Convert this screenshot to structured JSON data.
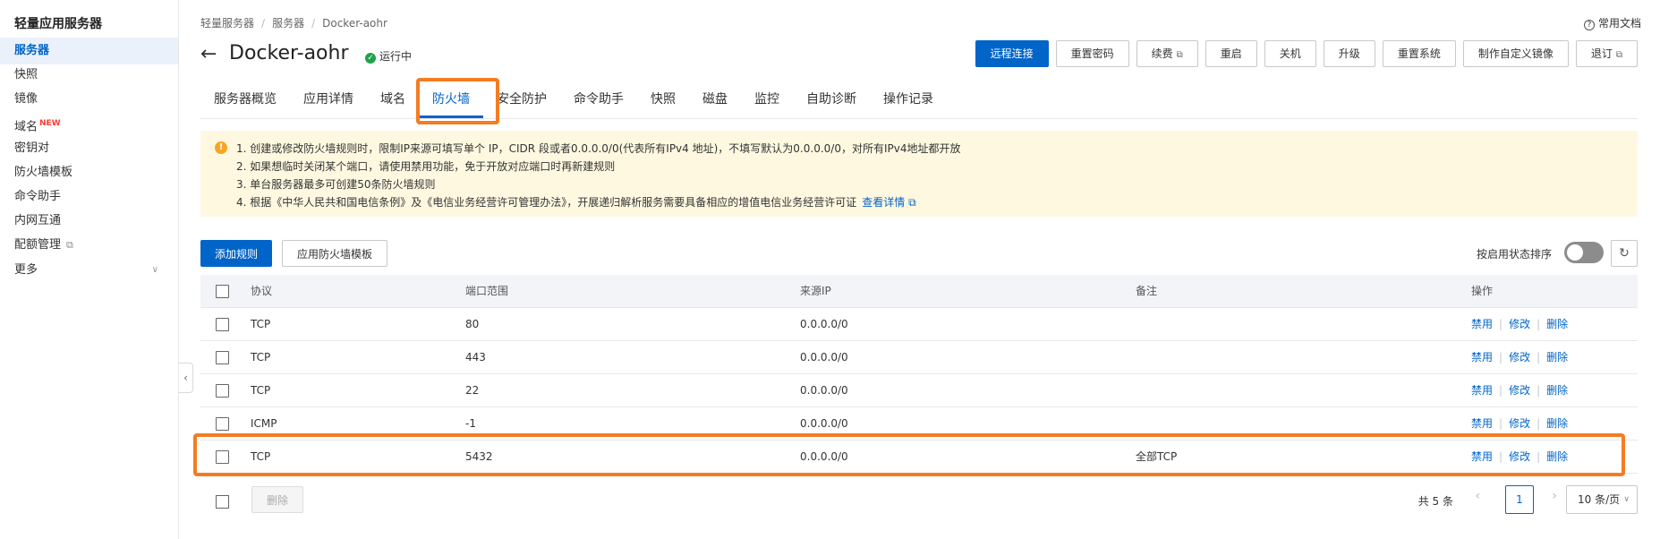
{
  "sidebar": {
    "title": "轻量应用服务器",
    "items": [
      {
        "label": "服务器"
      },
      {
        "label": "快照"
      },
      {
        "label": "镜像"
      },
      {
        "label": "域名",
        "badge": "NEW"
      },
      {
        "label": "密钥对"
      },
      {
        "label": "防火墙模板"
      },
      {
        "label": "命令助手"
      },
      {
        "label": "内网互通"
      },
      {
        "label": "配额管理"
      },
      {
        "label": "更多"
      }
    ],
    "collapse_icon": "‹"
  },
  "header": {
    "breadcrumb": [
      "轻量服务器",
      "服务器",
      "Docker-aohr"
    ],
    "docs_link": "常用文档",
    "title": "Docker-aohr",
    "status": "运行中",
    "status_color": "#1fa24a"
  },
  "actions": {
    "remote": "远程连接",
    "reset_password": "重置密码",
    "renew": "续费",
    "restart": "重启",
    "shutdown": "关机",
    "upgrade": "升级",
    "reset_system": "重置系统",
    "custom_image": "制作自定义镜像",
    "refund": "退订"
  },
  "tabs": [
    "服务器概览",
    "应用详情",
    "域名",
    "防火墙",
    "安全防护",
    "命令助手",
    "快照",
    "磁盘",
    "监控",
    "自助诊断",
    "操作记录"
  ],
  "notice": {
    "lines": [
      "1. 创建或修改防火墙规则时，限制IP来源可填写单个 IP，CIDR 段或者0.0.0.0/0(代表所有IPv4 地址)，不填写默认为0.0.0.0/0，对所有IPv4地址都开放",
      "2. 如果想临时关闭某个端口，请使用禁用功能，免于开放对应端口时再新建规则",
      "3. 单台服务器最多可创建50条防火墙规则",
      "4. 根据《中华人民共和国电信条例》及《电信业务经营许可管理办法》，开展递归解析服务需要具备相应的增值电信业务经营许可证"
    ],
    "link": "查看详情"
  },
  "toolbar": {
    "add_rule": "添加规则",
    "apply_template": "应用防火墙模板",
    "sort_label": "按启用状态排序"
  },
  "table": {
    "headers": {
      "protocol": "协议",
      "port": "端口范围",
      "source": "来源IP",
      "note": "备注",
      "ops": "操作"
    },
    "rows": [
      {
        "protocol": "TCP",
        "port": "80",
        "source": "0.0.0.0/0",
        "note": ""
      },
      {
        "protocol": "TCP",
        "port": "443",
        "source": "0.0.0.0/0",
        "note": ""
      },
      {
        "protocol": "TCP",
        "port": "22",
        "source": "0.0.0.0/0",
        "note": ""
      },
      {
        "protocol": "ICMP",
        "port": "-1",
        "source": "0.0.0.0/0",
        "note": ""
      },
      {
        "protocol": "TCP",
        "port": "5432",
        "source": "0.0.0.0/0",
        "note": "全部TCP"
      }
    ],
    "ops": {
      "disable": "禁用",
      "edit": "修改",
      "delete": "删除"
    }
  },
  "footer": {
    "delete": "删除",
    "total": "共 5 条",
    "page": "1",
    "page_size": "10 条/页"
  },
  "colors": {
    "primary": "#0064c8",
    "highlight": "#f57c22",
    "notice_bg": "#fff8e1"
  }
}
